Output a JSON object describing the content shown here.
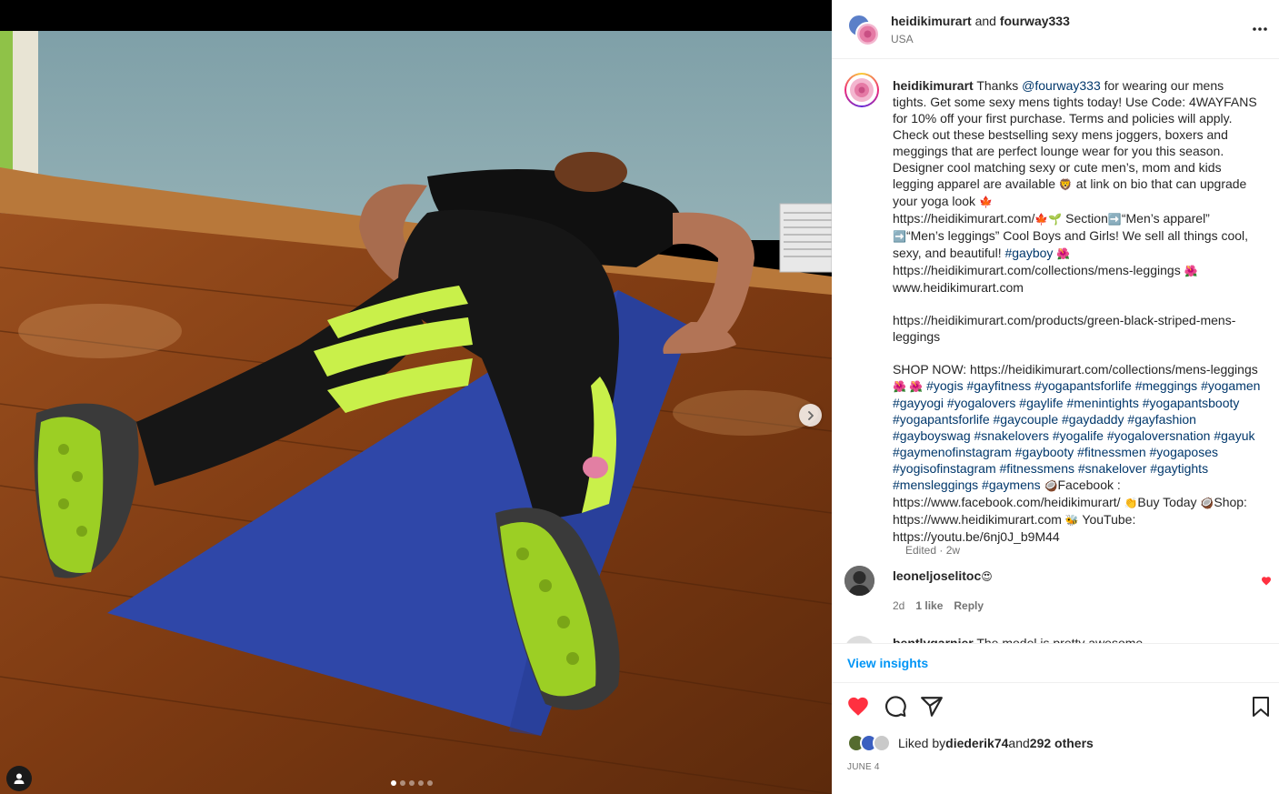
{
  "header": {
    "author": "heidikimurart",
    "joiner": "and",
    "collaborator": "fourway333",
    "location": "USA"
  },
  "caption": {
    "username": "heidikimurart",
    "p1": " Thanks ",
    "mention": "@fourway333",
    "p2": " for wearing our mens tights. Get some sexy mens tights today! Use Code: 4WAYFANS for 10% off your first purchase. Terms and policies will apply. Check out these bestselling sexy mens joggers, boxers and meggings that are perfect lounge wear for you this season. Designer cool matching sexy or cute men’s, mom and kids legging apparel are available ",
    "e1": "🦁",
    "p3": " at link on bio that can upgrade your yoga look ",
    "e2": "🍁",
    "p4": "\nhttps://heidikimurart.com/",
    "e3": "🍁🌱",
    "p5": " Section",
    "e4": "➡️",
    "p6": "“Men’s apparel”\n",
    "e5": "➡️",
    "p7": "“Men’s leggings” Cool Boys and Girls! We sell all things cool, sexy, and beautiful! ",
    "tag_gayboy": "#gayboy",
    "e6": "🌺",
    "p8": "\nhttps://heidikimurart.com/collections/mens-leggings ",
    "e7": "🌺",
    "p9": "\nwww.heidikimurart.com\n\nhttps://heidikimurart.com/products/green-black-striped-mens-leggings\n\nSHOP NOW: https://heidikimurart.com/collections/mens-leggings ",
    "e8": "🌺 🌺",
    "hashtags": " #yogis #gayfitness #yogapantsforlife #meggings #yogamen #gayyogi #yogalovers #gaylife #menintights #yogapantsbooty #yogapantsforlife #gaycouple #gaydaddy #gayfashion #gayboyswag #snakelovers #yogalife #yogaloversnation #gayuk #gaymenofinstagram #gaybooty #fitnessmen #yogaposes #yogisofinstagram #fitnessmens #snakelover #gaytights #mensleggings #gaymens ",
    "e9": "🥥",
    "p10": "Facebook : https://www.facebook.com/heidikimurart/ ",
    "e10": "👏",
    "p11": "Buy Today ",
    "e11": "🥥",
    "p12": "Shop: https://www.heidikimurart.com ",
    "e12": "🐝",
    "p13": " YouTube: https://youtu.be/6nj0J_b9M44",
    "meta": "Edited · 2w"
  },
  "comment1": {
    "username": "leoneljoselitoc",
    "emoji": "😍",
    "age": "2d",
    "likes": "1 like",
    "reply": "Reply"
  },
  "comment2": {
    "username": "bentlygarnier",
    "text": " The model is pretty awesome"
  },
  "insights_label": "View insights",
  "likes": {
    "prefix": "Liked by ",
    "user": "diederik74",
    "middle": " and ",
    "others": "292 others"
  },
  "date": "JUNE 4",
  "carousel": {
    "slides": 5,
    "active": 1
  },
  "colors": {
    "like_red": "#ff3040",
    "link_blue": "#0095f6",
    "mention_blue": "#00376b",
    "mat_blue": "#2f47a8",
    "neon": "#c9f04a"
  },
  "icons": [
    "next-chevron-icon",
    "user-tag-icon",
    "more-icon",
    "heart-icon",
    "comment-icon",
    "share-icon",
    "save-icon"
  ]
}
